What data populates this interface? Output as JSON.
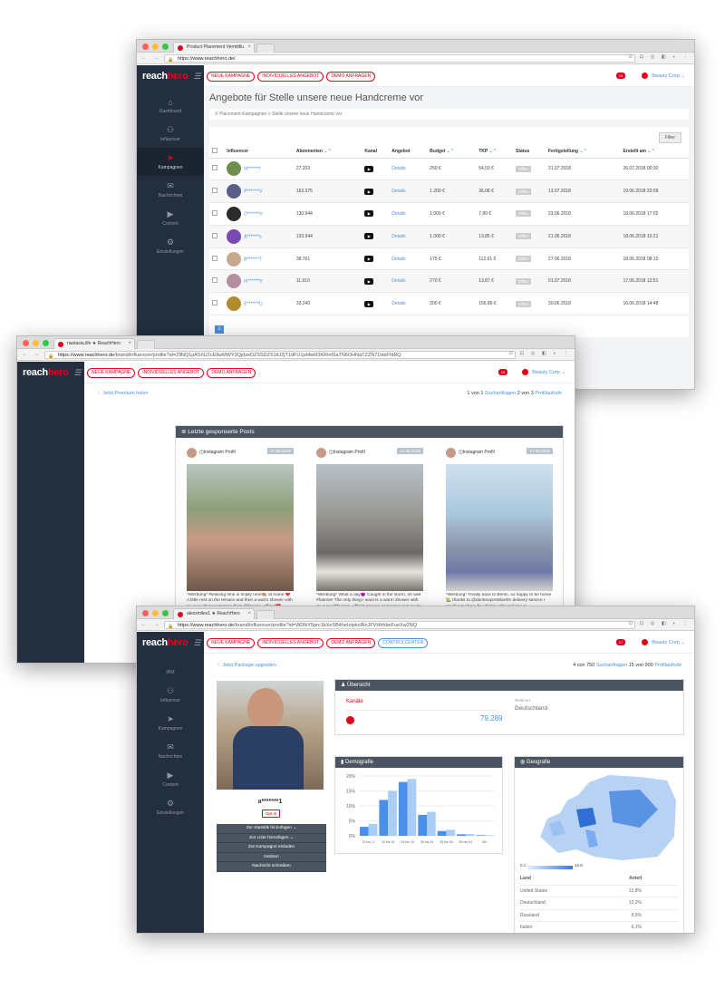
{
  "brand": {
    "logo_main": "reach",
    "logo_accent": "hero",
    "accent": "#e3001b",
    "link": "#4a90d9",
    "sidebar_bg": "#232f3f"
  },
  "w1": {
    "tab_title": "Product Placement Vermittlu",
    "url_host": "https://www.reachhero.de/",
    "url_path": "",
    "sidebar": [
      {
        "icon": "⌂",
        "label": "Dashboard"
      },
      {
        "icon": "⚇",
        "label": "Influencer"
      },
      {
        "icon": "➤",
        "label": "Kampagnen",
        "active": true
      },
      {
        "icon": "✉",
        "label": "Nachrichten"
      },
      {
        "icon": "▶",
        "label": "Content"
      },
      {
        "icon": "⚙",
        "label": "Einstellungen"
      }
    ],
    "buttons": [
      "NEUE KAMPAGNE",
      "INDIVIDUELLES ANGEBOT",
      "DEMO ANFRAGEN"
    ],
    "notif": "15",
    "user": "Beauty Corp",
    "title": "Angebote für Stelle unsere neue Handcreme vor",
    "crumb": "Placement-Kampagnen  >  Stelle unsere neue Handcreme vor",
    "filter": "Filter",
    "headers": [
      "Influencer",
      "Abonnenten",
      "Kanal",
      "Angebot",
      "Budget",
      "TKP",
      "Status",
      "Fertigstellung",
      "Erstellt am"
    ],
    "rows": [
      {
        "name": "N*******r",
        "subs": "27.203",
        "offer": "Details",
        "budget": "250 €",
        "tkp": "54,03 €",
        "status": "Offen",
        "due": "31.07.2018",
        "created": "26.07.2018 00:30",
        "color": "#6a8f4e"
      },
      {
        "name": "P*******V",
        "subs": "163.375",
        "offer": "Details",
        "budget": "1.200 €",
        "tkp": "36,08 €",
        "status": "Offen",
        "due": "13.07.2018",
        "created": "19.06.2018 20:09",
        "color": "#5a5f8a"
      },
      {
        "name": "D*******V",
        "subs": "130.944",
        "offer": "Details",
        "budget": "1.000 €",
        "tkp": "7,80 €",
        "status": "Offen",
        "due": "23.06.2018",
        "created": "18.06.2018 17:02",
        "color": "#2b2b2b"
      },
      {
        "name": "A*******s",
        "subs": "133.944",
        "offer": "Details",
        "budget": "1.000 €",
        "tkp": "13,85 €",
        "status": "Offen",
        "due": "21.06.2018",
        "created": "18.06.2018 13:21",
        "color": "#7a4ab0"
      },
      {
        "name": "B*******T",
        "subs": "38.761",
        "offer": "Details",
        "budget": "175 €",
        "tkp": "112,61 €",
        "status": "Offen",
        "due": "27.06.2018",
        "created": "18.06.2018 08:10",
        "color": "#c9a98e"
      },
      {
        "name": "m*******e",
        "subs": "11.910",
        "offer": "Details",
        "budget": "270 €",
        "tkp": "13,87 €",
        "status": "Offen",
        "due": "01.07.2018",
        "created": "17.06.2018 12:51",
        "color": "#b48da0"
      },
      {
        "name": "E*******U",
        "subs": "33.240",
        "offer": "Details",
        "budget": "200 €",
        "tkp": "156,86 €",
        "status": "Offen",
        "due": "30.06.2018",
        "created": "16.06.2018 14:48",
        "color": "#b38a2e"
      }
    ],
    "page": "1"
  },
  "w2": {
    "tab_title": "nastasia.life ★ ReachHero",
    "url_host": "https://www.reachhero.de",
    "url_path": "/brand/influencer/profile?id=ZllNQ1pAShU2cE9wMWY3QjdzeDZSSDZS1tU2jT1dFU1pbfwi93KRmlSaTN6OHNaTZZN71lxbFhtRQ",
    "buttons": [
      "NEUE KAMPAGNE",
      "INDIVIDUELLES ANGEBOT",
      "DEMO ANFRAGEN"
    ],
    "notif": "15",
    "user": "Beauty Corp",
    "premium": "Jetzt Premium holen",
    "count1_pre": "1 von 1 ",
    "count1_link": "Suchanfragen",
    "count2_pre": "  2 von 3 ",
    "count2_link": "Profilaufrufe",
    "posts_title": "Letzte gesponserte Posts",
    "posts": [
      {
        "label": "Instagram Profil",
        "date": "07.06.2018",
        "caption": "*Werbung* Relaxing time is finally here🍉 at home ❤️ A little rest on the terrace and then a warm shower with my new shower sponge from @foamie_official❤️"
      },
      {
        "label": "Instagram Profil",
        "date": "21.05.2018",
        "caption": "*Werbung* What a day😈 Caught in the storm, oh well #foamie! The only thing I want is a warm shower with my new @foamie_official sponge and some rest on my ..."
      },
      {
        "label": "Instagram Profil",
        "date": "17.05.2018",
        "caption": "*Werbung* Finally back to Berlin, so happy to be home🏡 thanks to @durstexpressberlin delivery service I could get all my fav drinks without living m..."
      }
    ]
  },
  "w3": {
    "tab_title": "alexxmiles1 ★ ReachHero",
    "url_host": "https://www.reachhero.de",
    "url_path": "/brand/influencer/profile?id=WDlkY5prc1bXeSB4heIolpkclRnJFVHhhbnFueXw2NQ",
    "sidebar": [
      {
        "icon": "",
        "label": "IRM"
      },
      {
        "icon": "⚇",
        "label": "Influencer"
      },
      {
        "icon": "➤",
        "label": "Kampagnen"
      },
      {
        "icon": "✉",
        "label": "Nachrichten"
      },
      {
        "icon": "▶",
        "label": "Content"
      },
      {
        "icon": "⚙",
        "label": "Einstellungen"
      }
    ],
    "buttons": [
      "NEUE KAMPAGNE",
      "INDIVIDUELLES ANGEBOT",
      "DEMO ANFRAGEN",
      "CONTROLCENTER"
    ],
    "notif": "17",
    "user": "Beauty Corp",
    "upgrade": "Jetzt Package upgraden",
    "count1_pre": "4 von 750 ",
    "count1_link": "Suchanfragen",
    "count2_pre": "  15 von 900 ",
    "count2_link": "Profilaufrufe",
    "name": "a*******1",
    "optin": "Opt-in",
    "actions": [
      "Zur Statistik hinzufügen ⌄",
      "Zur Liste hinzufügen ⌄",
      "Zur Kampagne einladen",
      "Notizen",
      "Nachricht schreiben"
    ],
    "overview_title": "Übersicht",
    "kanaele": "Kanäle",
    "followers": "79.289",
    "wohnort_label": "Wohnort",
    "wohnort": "Deutschland",
    "demo_title": "Demografie",
    "geo_title": "Geografie",
    "geo_scale_min": "0.1",
    "geo_scale_max": "12.8",
    "geo_headers": [
      "Land",
      "Anteil"
    ],
    "geo_rows": [
      [
        "United States",
        "12,8%"
      ],
      [
        "Deutschland",
        "12,2%"
      ],
      [
        "Russland",
        "9,5%"
      ],
      [
        "Italien",
        "6,1%"
      ]
    ]
  },
  "chart_data": {
    "type": "bar",
    "categories": [
      "13 bis 17",
      "18 bis 24",
      "25 bis 34",
      "35 bis 44",
      "45 bis 54",
      "55 bis 64",
      "65+"
    ],
    "ylim": [
      0,
      20
    ],
    "yticks": [
      "0%",
      "5%",
      "10%",
      "15%",
      "20%"
    ],
    "series": [
      {
        "values": [
          3,
          12,
          18,
          7,
          1.6,
          0.5,
          0.2
        ],
        "color": "#4a8fe8"
      },
      {
        "values": [
          4,
          15,
          19,
          8,
          2,
          0.6,
          0.2
        ],
        "color": "#a9cdf5"
      }
    ]
  }
}
